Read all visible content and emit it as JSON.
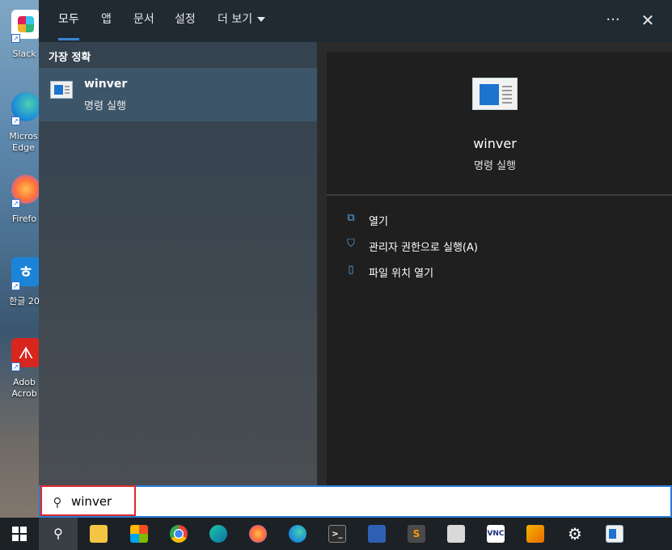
{
  "desktop": {
    "icons": [
      {
        "label": "Slack",
        "color": "#e01e5a"
      },
      {
        "label": "Micros Edge",
        "color": "#1f8fd8"
      },
      {
        "label": "Firefo",
        "color": "#ff7139"
      },
      {
        "label": "한글 20",
        "color": "#1c84d8"
      },
      {
        "label": "Adob Acrob",
        "color": "#d7261e"
      }
    ]
  },
  "tabs": [
    "모두",
    "앱",
    "문서",
    "설정",
    "더 보기"
  ],
  "header": {
    "more_label": "···",
    "close_label": "✕"
  },
  "left_pane": {
    "section_title": "가장 정확",
    "result": {
      "name": "winver",
      "type": "명령 실행"
    }
  },
  "right_pane": {
    "name": "winver",
    "type": "명령 실행",
    "actions": [
      {
        "label": "열기",
        "icon": "open-icon"
      },
      {
        "label": "관리자 권한으로 실행(A)",
        "icon": "admin-shield-icon"
      },
      {
        "label": "파일 위치 열기",
        "icon": "file-location-icon"
      }
    ]
  },
  "search": {
    "value": "winver"
  },
  "colors": {
    "accent": "#2c7bd4",
    "highlight": "#e0282e"
  }
}
